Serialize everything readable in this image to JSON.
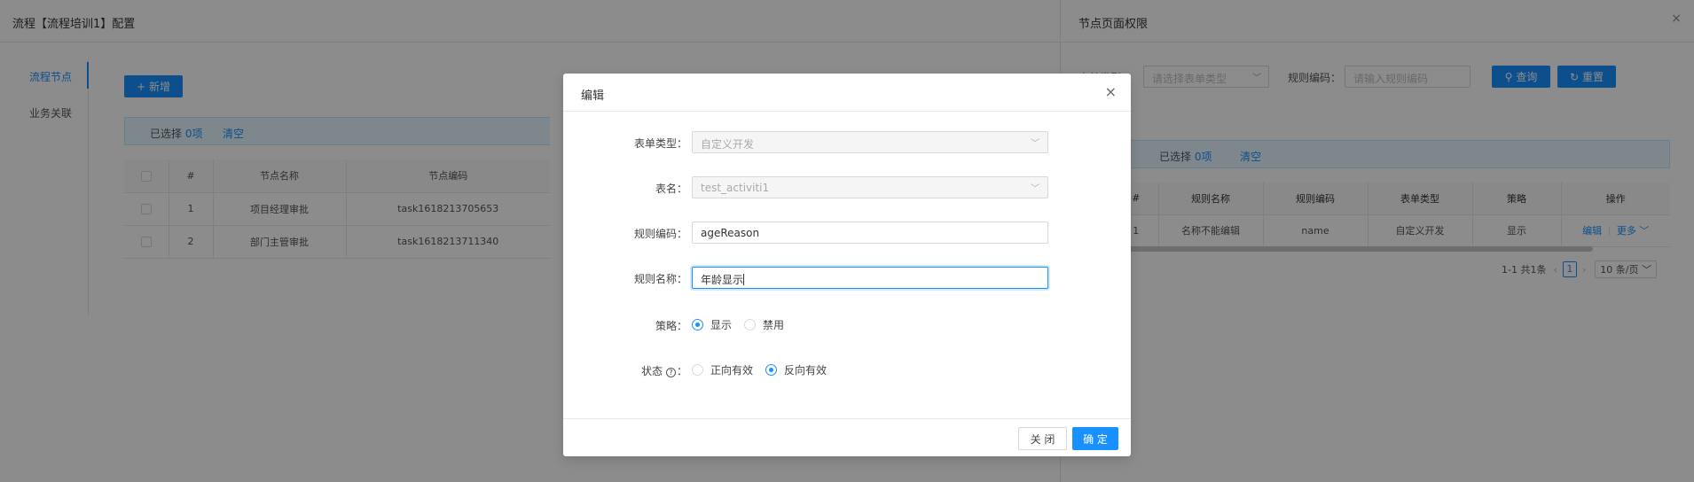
{
  "base": {
    "title": "流程【流程培训1】配置",
    "nav": [
      "流程节点",
      "业务关联"
    ],
    "add_label": "新增",
    "selection": {
      "prefix": "已选择",
      "count": "0项",
      "clear": "清空"
    },
    "table": {
      "headers": [
        "#",
        "节点名称",
        "节点编码"
      ],
      "rows": [
        {
          "no": "1",
          "name": "项目经理审批",
          "code": "task1618213705653"
        },
        {
          "no": "2",
          "name": "部门主管审批",
          "code": "task1618213711340"
        }
      ]
    }
  },
  "drawer": {
    "title": "节点页面权限",
    "close": "×",
    "filters": {
      "type_label": "表单类型：",
      "type_placeholder": "请选择表单类型",
      "code_label": "规则编码：",
      "code_placeholder": "请输入规则编码"
    },
    "query_label": "查询",
    "reset_label": "重置",
    "selection": {
      "prefix": "已选择",
      "count": "0项",
      "clear": "清空"
    },
    "table": {
      "headers": [
        "#",
        "规则名称",
        "规则编码",
        "表单类型",
        "策略",
        "操作"
      ],
      "rows": [
        {
          "no": "1",
          "name": "名称不能编辑",
          "code": "name",
          "type": "自定义开发",
          "strategy": "显示",
          "edit": "编辑",
          "more": "更多"
        }
      ]
    },
    "pager": {
      "summary": "1-1 共1条",
      "page": "1",
      "size": "10 条/页"
    }
  },
  "modal": {
    "title": "编辑",
    "close": "×",
    "fields": {
      "form_type": {
        "label": "表单类型：",
        "value": "自定义开发"
      },
      "table_name": {
        "label": "表名：",
        "value": "test_activiti1"
      },
      "rule_code": {
        "label": "规则编码：",
        "value": "ageReason"
      },
      "rule_name": {
        "label": "规则名称：",
        "value": "年龄显示"
      }
    },
    "strategy": {
      "label": "策略：",
      "options": [
        "显示",
        "禁用"
      ],
      "selected": "显示"
    },
    "status": {
      "label": "状态",
      "help": "?",
      "suffix": "：",
      "options": [
        "正向有效",
        "反向有效"
      ],
      "selected": "反向有效"
    },
    "footer": {
      "cancel": "关 闭",
      "ok": "确 定"
    }
  },
  "colors": {
    "primary": "#1890ff",
    "mask": "rgba(0,0,0,0.45)"
  }
}
